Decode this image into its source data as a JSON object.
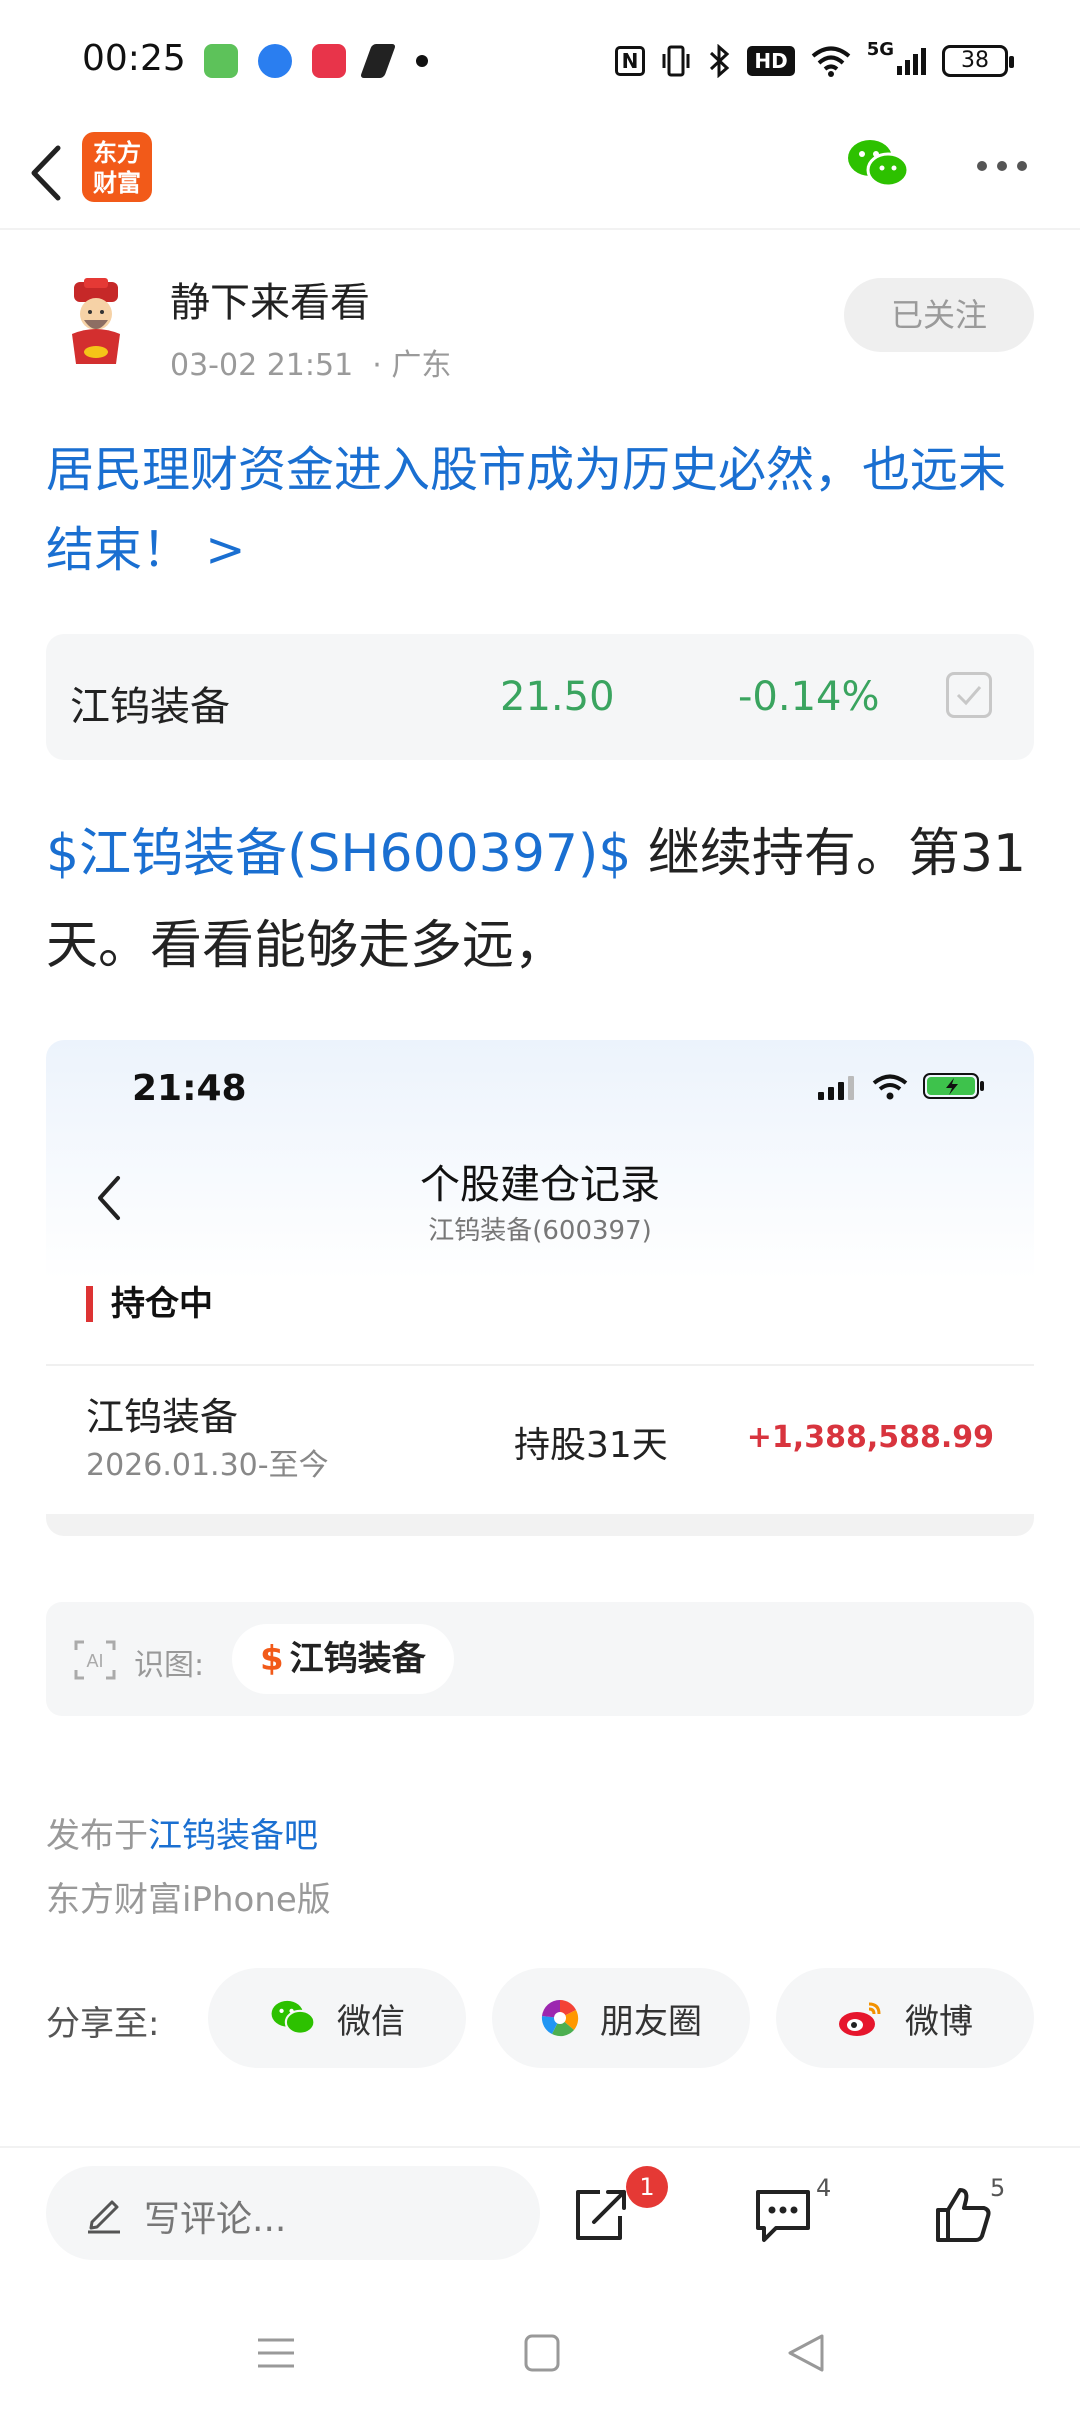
{
  "status_bar": {
    "time": "00:25",
    "nfc": "N",
    "hd": "HD",
    "network": "5G",
    "battery": "38"
  },
  "app": {
    "logo_line1": "东方",
    "logo_line2": "财富"
  },
  "author": {
    "name": "静下来看看",
    "date": "03-02 21:51",
    "location": "· 广东",
    "follow_label": "已关注"
  },
  "post": {
    "title": "居民理财资金进入股市成为历史必然，也远未结束！ >",
    "tag": "$江钨装备(SH600397)$",
    "body": " 继续持有。第31天。看看能够走多远，"
  },
  "stock_card": {
    "name": "江钨装备",
    "price": "21.50",
    "change": "-0.14%"
  },
  "screenshot": {
    "time": "21:48",
    "title": "个股建仓记录",
    "subtitle": "江钨装备(600397)",
    "section": "持仓中",
    "stock": "江钨装备",
    "date_range": "2026.01.30-至今",
    "hold_days": "持股31天",
    "profit": "+1,388,588.99"
  },
  "image_recog": {
    "icon_text": "AI",
    "label": "识图:",
    "dollar": "$",
    "chip": "江钨装备"
  },
  "posted_in": {
    "prefix": "发布于",
    "bar": "江钨装备吧"
  },
  "source": "东方财富iPhone版",
  "share": {
    "label": "分享至:",
    "wechat": "微信",
    "moments": "朋友圈",
    "weibo": "微博"
  },
  "bottom_bar": {
    "placeholder": "写评论...",
    "share_badge": "1",
    "comment_count": "4",
    "like_count": "5"
  },
  "colors": {
    "brand": "#f25a19",
    "link": "#1a6fd1",
    "down": "#3aa45f",
    "profit": "#d8343e"
  }
}
